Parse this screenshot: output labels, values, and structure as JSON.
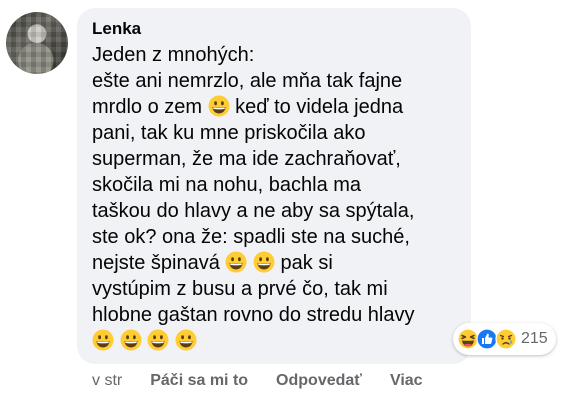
{
  "comment": {
    "author": "Lenka",
    "lines": [
      "Jeden z mnohých:",
      "ešte ani nemrzlo, ale mňa tak fajne",
      "mrdlo o zem ",
      " keď to videla jedna",
      "pani, tak ku mne priskočila ako",
      "superman, že ma ide zachraňovať,",
      "skočila mi na nohu, bachla ma",
      "taškou do hlavy a ne aby sa spýtala,",
      "ste ok? ona že: spadli ste na suché,",
      "nejste špinavá ",
      " pak si",
      "vystúpim z busu a prvé čo, tak mi",
      "hlobne gaštan rovno do stredu hlavy"
    ],
    "emoji_name": "grinning-face-emoji",
    "reactions": {
      "icons": [
        "laughing-face-icon",
        "like-thumb-icon",
        "sad-crying-face-icon"
      ],
      "count": "215"
    }
  },
  "actions": {
    "time": "v str",
    "like": "Páči sa mi to",
    "reply": "Odpovedať",
    "more": "Viac"
  },
  "colors": {
    "bubble": "#f0f2f5",
    "text": "#050505",
    "muted": "#65676b",
    "like_blue": "#1877f2",
    "emoji_yellow": "#ffcc33"
  }
}
